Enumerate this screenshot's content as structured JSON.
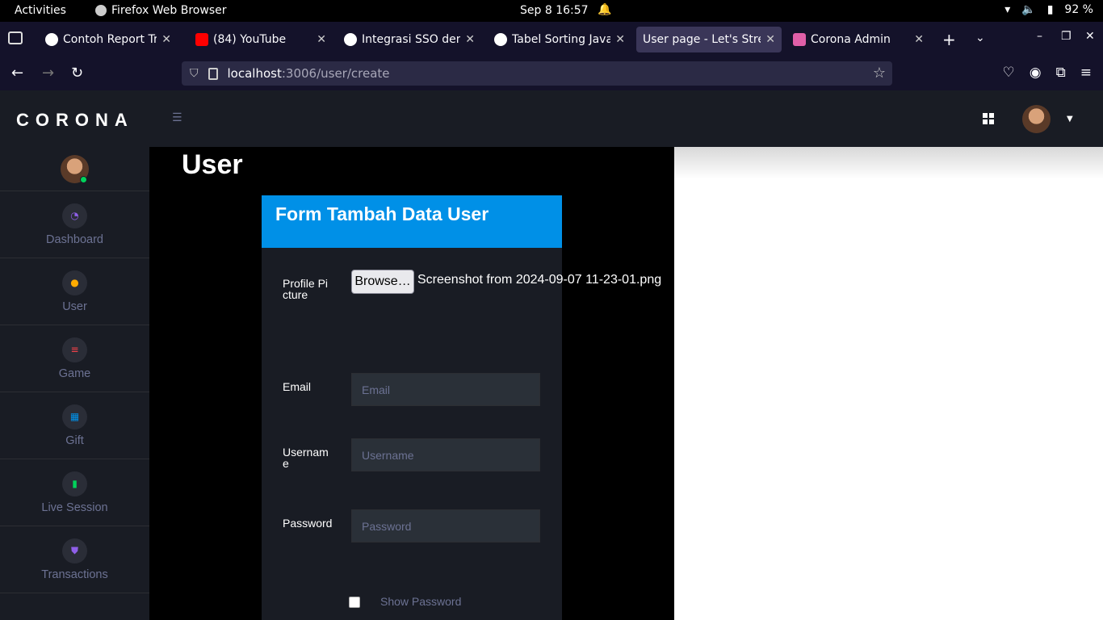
{
  "system_bar": {
    "activities": "Activities",
    "app_name": "Firefox Web Browser",
    "clock": "Sep 8  16:57",
    "battery": "92 %"
  },
  "browser": {
    "tabs": [
      {
        "label": "Contoh Report Tran",
        "favicon_color": "#ffffff",
        "active": false
      },
      {
        "label": "(84) YouTube",
        "favicon_color": "#ff0000",
        "active": false
      },
      {
        "label": "Integrasi SSO deng",
        "favicon_color": "#ffffff",
        "active": false
      },
      {
        "label": "Tabel Sorting JavaS",
        "favicon_color": "#ffffff",
        "active": false
      },
      {
        "label": "User page - Let's Strea",
        "favicon_color": "",
        "active": true
      },
      {
        "label": "Corona Admin",
        "favicon_color": "#e05fa8",
        "active": false
      }
    ],
    "url_host": "localhost",
    "url_path": ":3006/user/create"
  },
  "app": {
    "brand": "CORONA",
    "sidebar": {
      "items": [
        {
          "label": "Dashboard",
          "icon": "speedometer-icon",
          "color": "#8f5fe8"
        },
        {
          "label": "User",
          "icon": "user-circle-icon",
          "color": "#ffab00"
        },
        {
          "label": "Game",
          "icon": "playlist-play-icon",
          "color": "#fc424a"
        },
        {
          "label": "Gift",
          "icon": "table-icon",
          "color": "#0090e7"
        },
        {
          "label": "Live Session",
          "icon": "chart-bar-icon",
          "color": "#00d25b"
        },
        {
          "label": "Transactions",
          "icon": "security-icon",
          "color": "#8f5fe8"
        }
      ]
    },
    "page_title": "User",
    "form": {
      "title": "Form Tambah Data User",
      "profile_label": "Profile Picture",
      "browse_label": "Browse…",
      "file_name": "Screenshot from 2024-09-07 11-23-01.png",
      "email_label": "Email",
      "email_placeholder": "Email",
      "username_label": "Username",
      "username_placeholder": "Username",
      "password_label": "Password",
      "password_placeholder": "Password",
      "show_password_label": "Show Password"
    }
  },
  "colors": {
    "accent": "#0090e7",
    "sidebar_bg": "#191c24",
    "online": "#00d25b"
  }
}
